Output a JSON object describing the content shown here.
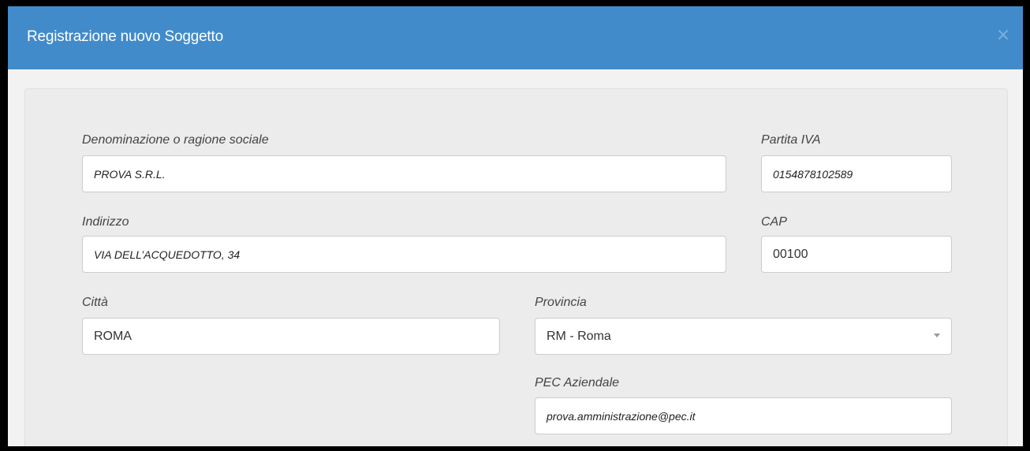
{
  "modal": {
    "title": "Registrazione nuovo Soggetto",
    "close_symbol": "×"
  },
  "form": {
    "denominazione": {
      "label": "Denominazione o ragione sociale",
      "value": "PROVA S.R.L."
    },
    "partita_iva": {
      "label": "Partita IVA",
      "value": "0154878102589"
    },
    "indirizzo": {
      "label": "Indirizzo",
      "value": "VIA DELL’ACQUEDOTTO, 34"
    },
    "cap": {
      "label": "CAP",
      "value": "00100"
    },
    "citta": {
      "label": "Città",
      "value": "ROMA"
    },
    "provincia": {
      "label": "Provincia",
      "value": "RM - Roma"
    },
    "pec": {
      "label": "PEC Aziendale",
      "value": "prova.amministrazione@pec.it"
    }
  },
  "colors": {
    "header": "#428bca",
    "panel": "#ececec",
    "input_border": "#cccccc"
  },
  "icons": {
    "close": "close-icon",
    "select_caret": "chevron-down-icon"
  }
}
